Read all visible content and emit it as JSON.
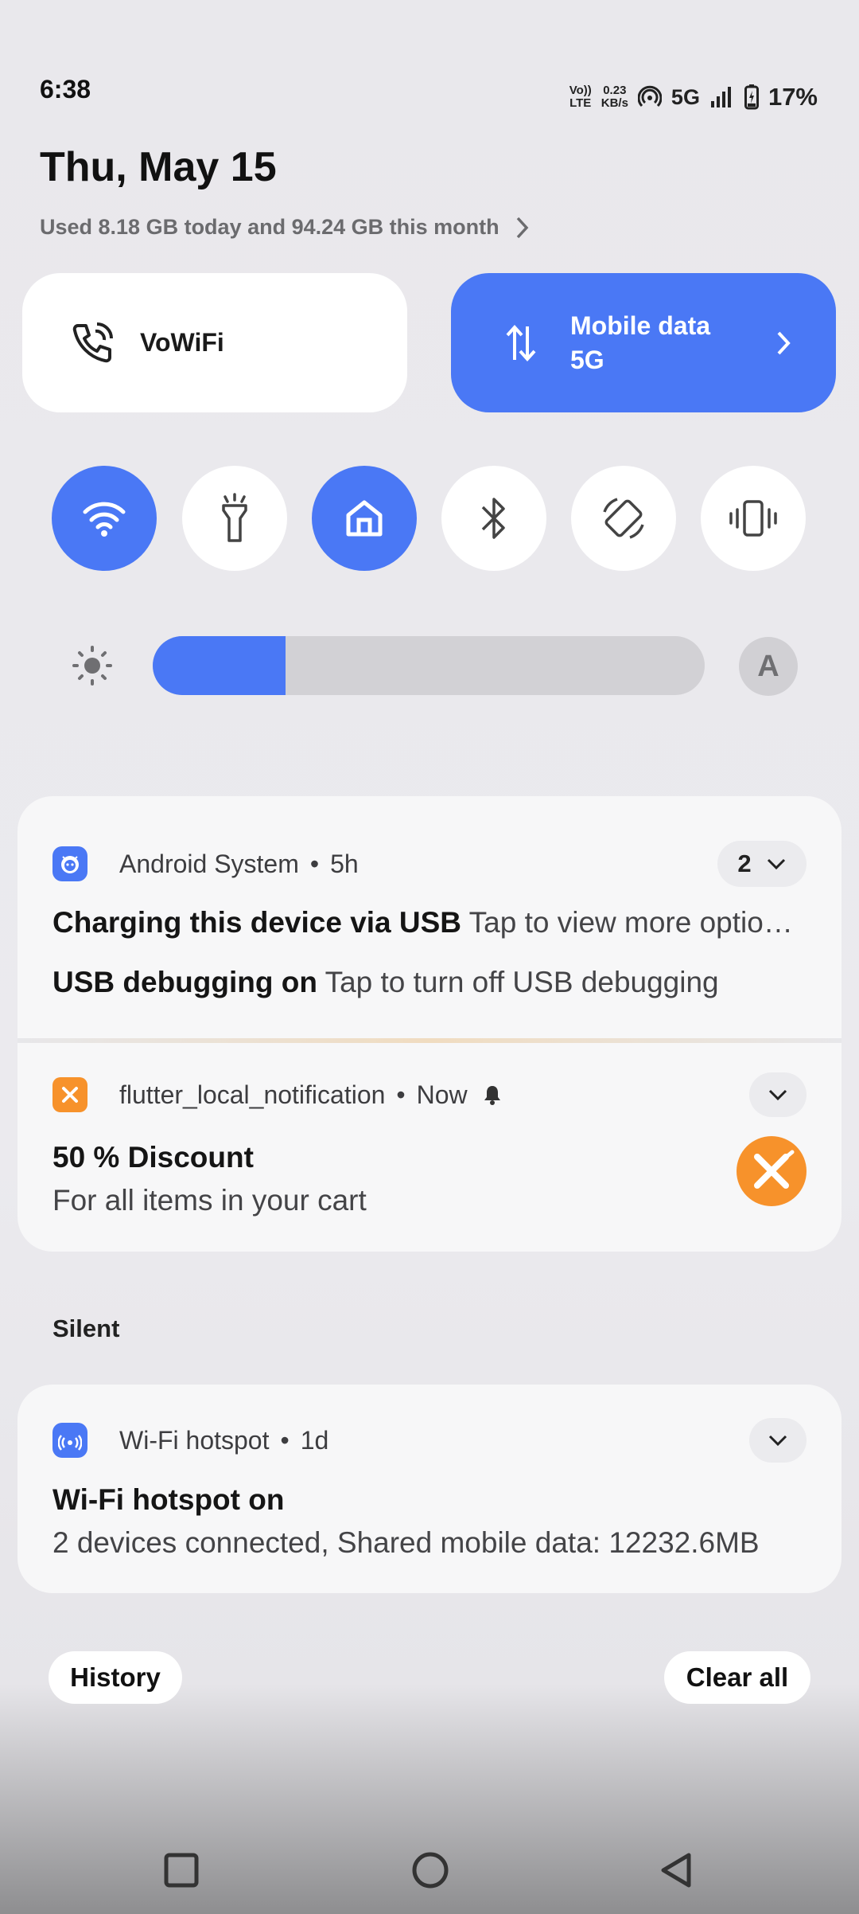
{
  "status_bar": {
    "time": "6:38",
    "volte_top": "Vo))",
    "volte_bottom": "LTE",
    "speed_value": "0.23",
    "speed_unit": "KB/s",
    "network": "5G",
    "battery": "17%",
    "battery_charge_fraction": 0.17
  },
  "header": {
    "date": "Thu, May 15",
    "data_usage": "Used 8.18 GB today and 94.24 GB this month"
  },
  "tiles": {
    "vowifi": {
      "label": "VoWiFi",
      "icon": "phone-wifi-icon"
    },
    "mobile_data": {
      "label": "Mobile data",
      "sub": "5G",
      "icon": "up-down-arrows-icon",
      "active": true
    }
  },
  "toggles": [
    {
      "name": "wifi",
      "icon": "wifi-icon",
      "active": true
    },
    {
      "name": "flashlight",
      "icon": "flashlight-icon",
      "active": false
    },
    {
      "name": "home",
      "icon": "home-icon",
      "active": true
    },
    {
      "name": "bluetooth",
      "icon": "bluetooth-icon",
      "active": false
    },
    {
      "name": "auto-rotate",
      "icon": "rotate-icon",
      "active": false
    },
    {
      "name": "vibrate",
      "icon": "vibrate-icon",
      "active": false
    }
  ],
  "brightness": {
    "level_fraction": 0.24,
    "auto_label": "A"
  },
  "notifications": {
    "android_system": {
      "app": "Android System",
      "time": "5h",
      "count": "2",
      "rows": [
        {
          "title": "Charging this device via USB",
          "text": "Tap to view more optio…"
        },
        {
          "title": "USB debugging on",
          "text": "Tap to turn off USB debugging"
        }
      ]
    },
    "flutter": {
      "app": "flutter_local_notification",
      "time": "Now",
      "title": "50 % Discount",
      "text": "For all items in your cart"
    },
    "silent_label": "Silent",
    "hotspot": {
      "app": "Wi-Fi hotspot",
      "time": "1d",
      "title": "Wi-Fi hotspot on",
      "text": "2 devices connected, Shared mobile data: 12232.6MB"
    }
  },
  "buttons": {
    "history": "History",
    "clear_all": "Clear all"
  },
  "colors": {
    "accent": "#4a78f5",
    "flutter_orange": "#f7922b",
    "card": "#f7f7f8"
  }
}
